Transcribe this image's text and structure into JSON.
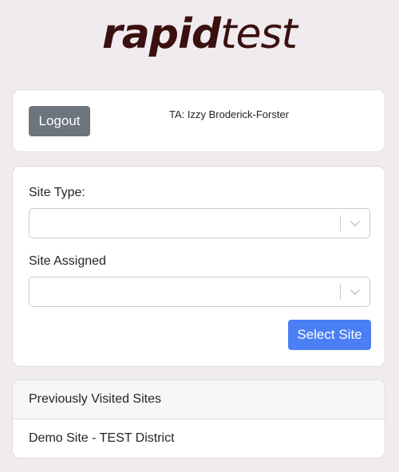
{
  "logo": {
    "bold_text": "rapid",
    "light_text": "test"
  },
  "user_card": {
    "logout_label": "Logout",
    "ta_label": "TA: Izzy Broderick-Forster"
  },
  "site_form": {
    "site_type_label": "Site Type:",
    "site_type_value": "",
    "site_assigned_label": "Site Assigned",
    "site_assigned_value": "",
    "select_button_label": "Select Site"
  },
  "previously_visited": {
    "title": "Previously Visited Sites",
    "items": [
      "Demo Site - TEST District"
    ]
  },
  "colors": {
    "background": "#f0ebef",
    "logo": "#3a1010",
    "logout_button": "#6c757d",
    "select_button": "#4a7ff5"
  },
  "icons": {
    "dropdown": "chevron-down-icon"
  }
}
